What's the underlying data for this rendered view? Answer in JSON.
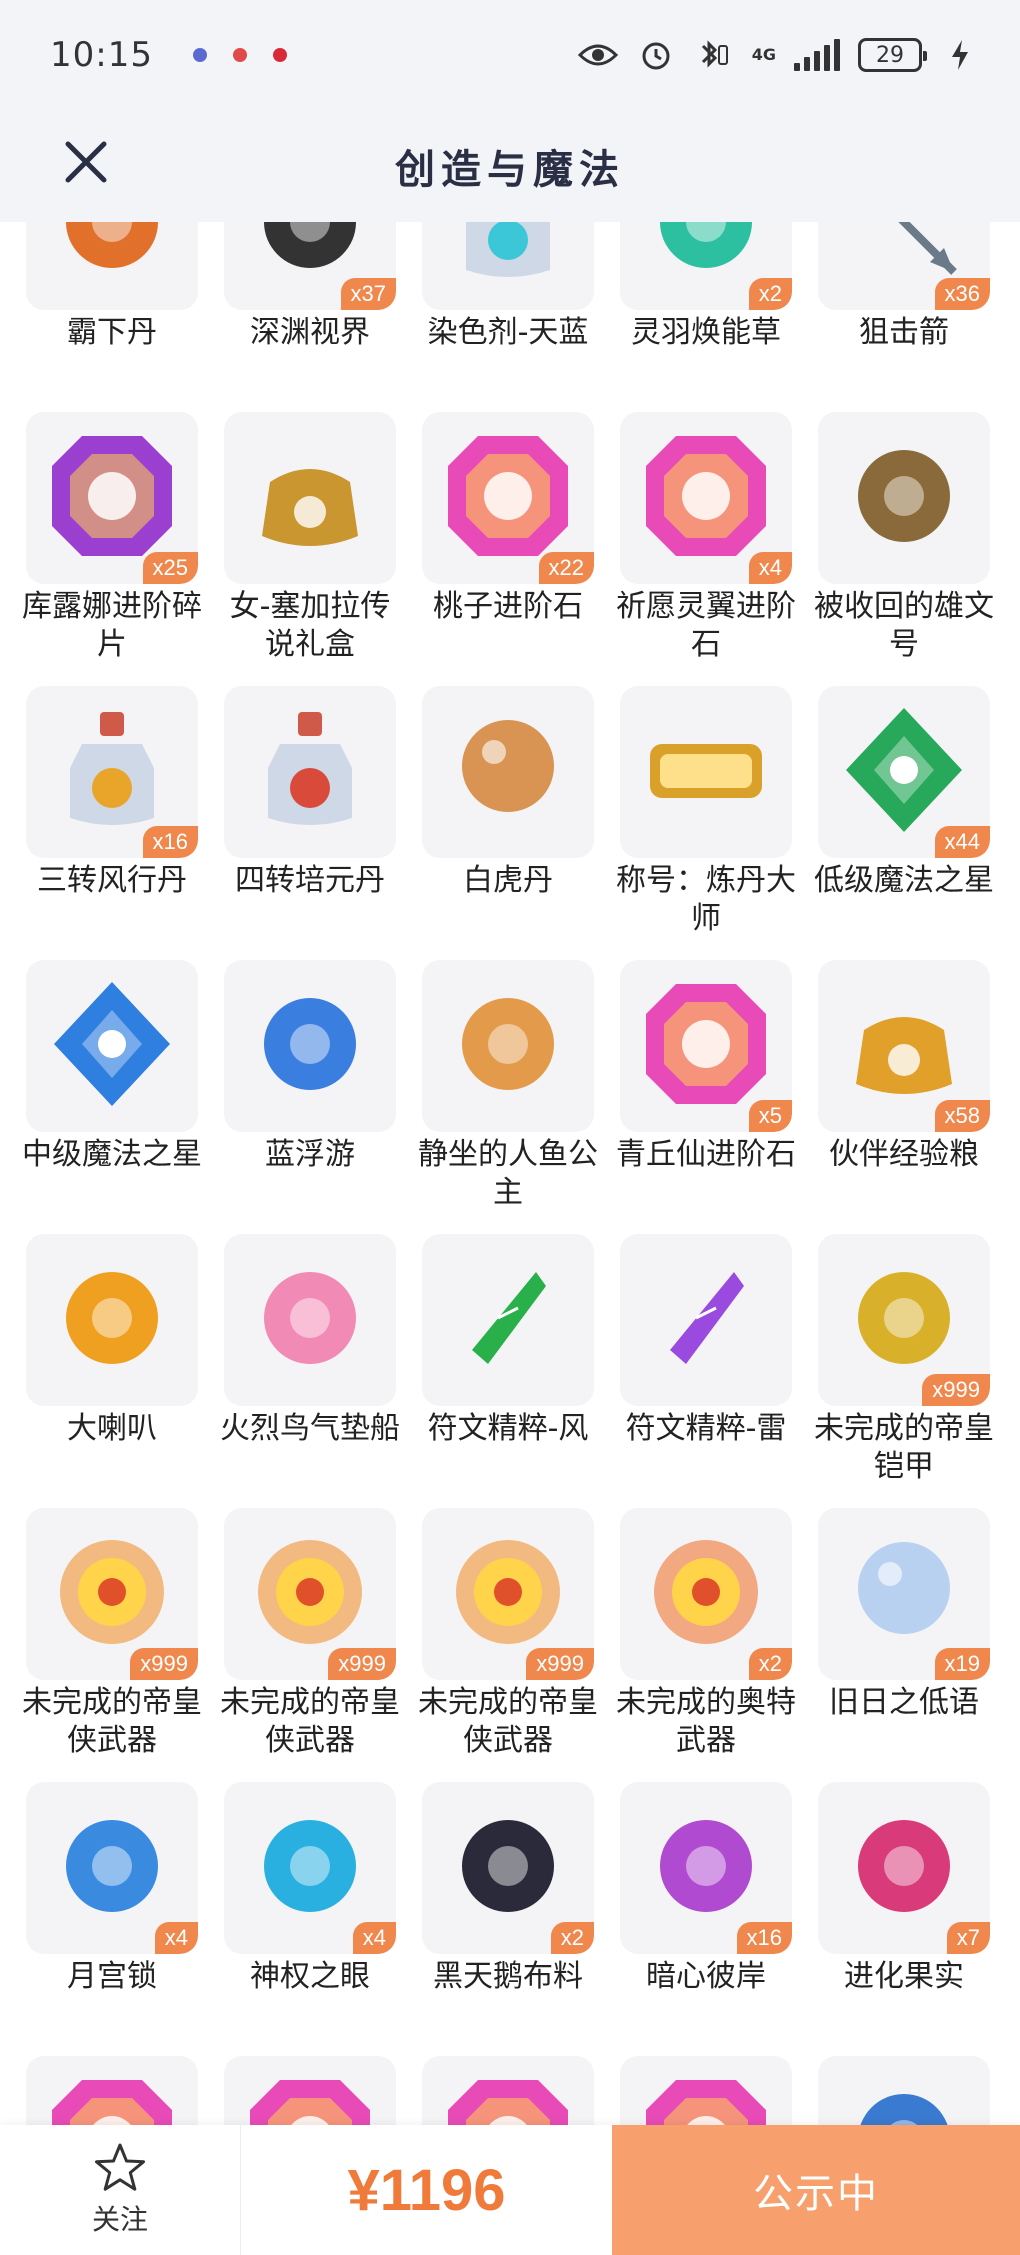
{
  "status_bar": {
    "time": "10:15",
    "network": "4G",
    "battery": "29"
  },
  "header": {
    "title": "创造与魔法"
  },
  "items": [
    {
      "name": "霸下丹",
      "count": "",
      "icon": "dan-icon",
      "color": "#e0702a"
    },
    {
      "name": "深渊视界",
      "count": "x37",
      "icon": "abyss-eye-icon",
      "color": "#333333"
    },
    {
      "name": "染色剂-天蓝",
      "count": "",
      "icon": "dye-bottle-icon",
      "color": "#3cc7d8"
    },
    {
      "name": "灵羽焕能草",
      "count": "x2",
      "icon": "feather-grass-icon",
      "color": "#2cbfa0"
    },
    {
      "name": "狙击箭",
      "count": "x36",
      "icon": "arrow-icon",
      "color": "#6a7a8a"
    },
    {
      "name": "库露娜进阶碎片",
      "count": "x25",
      "icon": "purple-gem-icon",
      "color": "#9b3fd1"
    },
    {
      "name": "女-塞加拉传说礼盒",
      "count": "",
      "icon": "treasure-chest-icon",
      "color": "#c9962f"
    },
    {
      "name": "桃子进阶石",
      "count": "x22",
      "icon": "pink-gem-icon",
      "color": "#e84bb7"
    },
    {
      "name": "祈愿灵翼进阶石",
      "count": "x4",
      "icon": "wing-gem-icon",
      "color": "#e84bb7"
    },
    {
      "name": "被收回的雄文号",
      "count": "",
      "icon": "ship-icon",
      "color": "#8a6a3a"
    },
    {
      "name": "三转风行丹",
      "count": "x16",
      "icon": "potion-bottle-icon",
      "color": "#e8a52a"
    },
    {
      "name": "四转培元丹",
      "count": "",
      "icon": "potion-bottle-icon",
      "color": "#d94a3a"
    },
    {
      "name": "白虎丹",
      "count": "",
      "icon": "orb-stand-icon",
      "color": "#d27a2a"
    },
    {
      "name": "称号：炼丹大师",
      "count": "",
      "icon": "title-badge-icon",
      "color": "#d9a02a"
    },
    {
      "name": "低级魔法之星",
      "count": "x44",
      "icon": "green-crystal-icon",
      "color": "#27a85a"
    },
    {
      "name": "中级魔法之星",
      "count": "",
      "icon": "blue-crystal-icon",
      "color": "#2f7fe0"
    },
    {
      "name": "蓝浮游",
      "count": "",
      "icon": "blue-dragon-icon",
      "color": "#3a7ee0"
    },
    {
      "name": "静坐的人鱼公主",
      "count": "",
      "icon": "mermaid-icon",
      "color": "#e39a4a"
    },
    {
      "name": "青丘仙进阶石",
      "count": "x5",
      "icon": "fox-gem-icon",
      "color": "#e84bb7"
    },
    {
      "name": "伙伴经验粮",
      "count": "x58",
      "icon": "paw-bag-icon",
      "color": "#e0a02a"
    },
    {
      "name": "大喇叭",
      "count": "",
      "icon": "megaphone-icon",
      "color": "#f0a020"
    },
    {
      "name": "火烈鸟气垫船",
      "count": "",
      "icon": "flamingo-icon",
      "color": "#f28ab6"
    },
    {
      "name": "符文精粹-风",
      "count": "",
      "icon": "rune-green-icon",
      "color": "#2ab04a"
    },
    {
      "name": "符文精粹-雷",
      "count": "",
      "icon": "rune-purple-icon",
      "color": "#9b4ae0"
    },
    {
      "name": "未完成的帝皇铠甲",
      "count": "x999",
      "icon": "armor-icon",
      "color": "#d9b02a"
    },
    {
      "name": "未完成的帝皇侠武器",
      "count": "x999",
      "icon": "fire-gear-icon",
      "color": "#f08a20"
    },
    {
      "name": "未完成的帝皇侠武器",
      "count": "x999",
      "icon": "fire-gear-icon",
      "color": "#f08a20"
    },
    {
      "name": "未完成的帝皇侠武器",
      "count": "x999",
      "icon": "fire-gear-icon",
      "color": "#f08a20"
    },
    {
      "name": "未完成的奥特武器",
      "count": "x2",
      "icon": "fire-blade-icon",
      "color": "#f06a20"
    },
    {
      "name": "旧日之低语",
      "count": "x19",
      "icon": "bubble-orb-icon",
      "color": "#a9c8f0"
    },
    {
      "name": "月宫锁",
      "count": "x4",
      "icon": "moon-lock-icon",
      "color": "#3a8ae0"
    },
    {
      "name": "神权之眼",
      "count": "x4",
      "icon": "eye-icon",
      "color": "#2ab0e0"
    },
    {
      "name": "黑天鹅布料",
      "count": "x2",
      "icon": "black-cloth-icon",
      "color": "#2a2a3a"
    },
    {
      "name": "暗心彼岸",
      "count": "x16",
      "icon": "flower-icon",
      "color": "#b04ad0"
    },
    {
      "name": "进化果实",
      "count": "x7",
      "icon": "berry-icon",
      "color": "#d93a7a"
    },
    {
      "name": "",
      "count": "",
      "icon": "pink-gem-icon",
      "color": "#e84bb7"
    },
    {
      "name": "",
      "count": "",
      "icon": "pink-gem-icon",
      "color": "#e84bb7"
    },
    {
      "name": "",
      "count": "",
      "icon": "pink-gem-icon",
      "color": "#e84bb7"
    },
    {
      "name": "",
      "count": "",
      "icon": "pink-gem-icon",
      "color": "#e84bb7"
    },
    {
      "name": "",
      "count": "",
      "icon": "blue-berry-icon",
      "color": "#3a7ad0"
    }
  ],
  "bottom_bar": {
    "follow_label": "关注",
    "price": "¥1196",
    "status_label": "公示中"
  }
}
